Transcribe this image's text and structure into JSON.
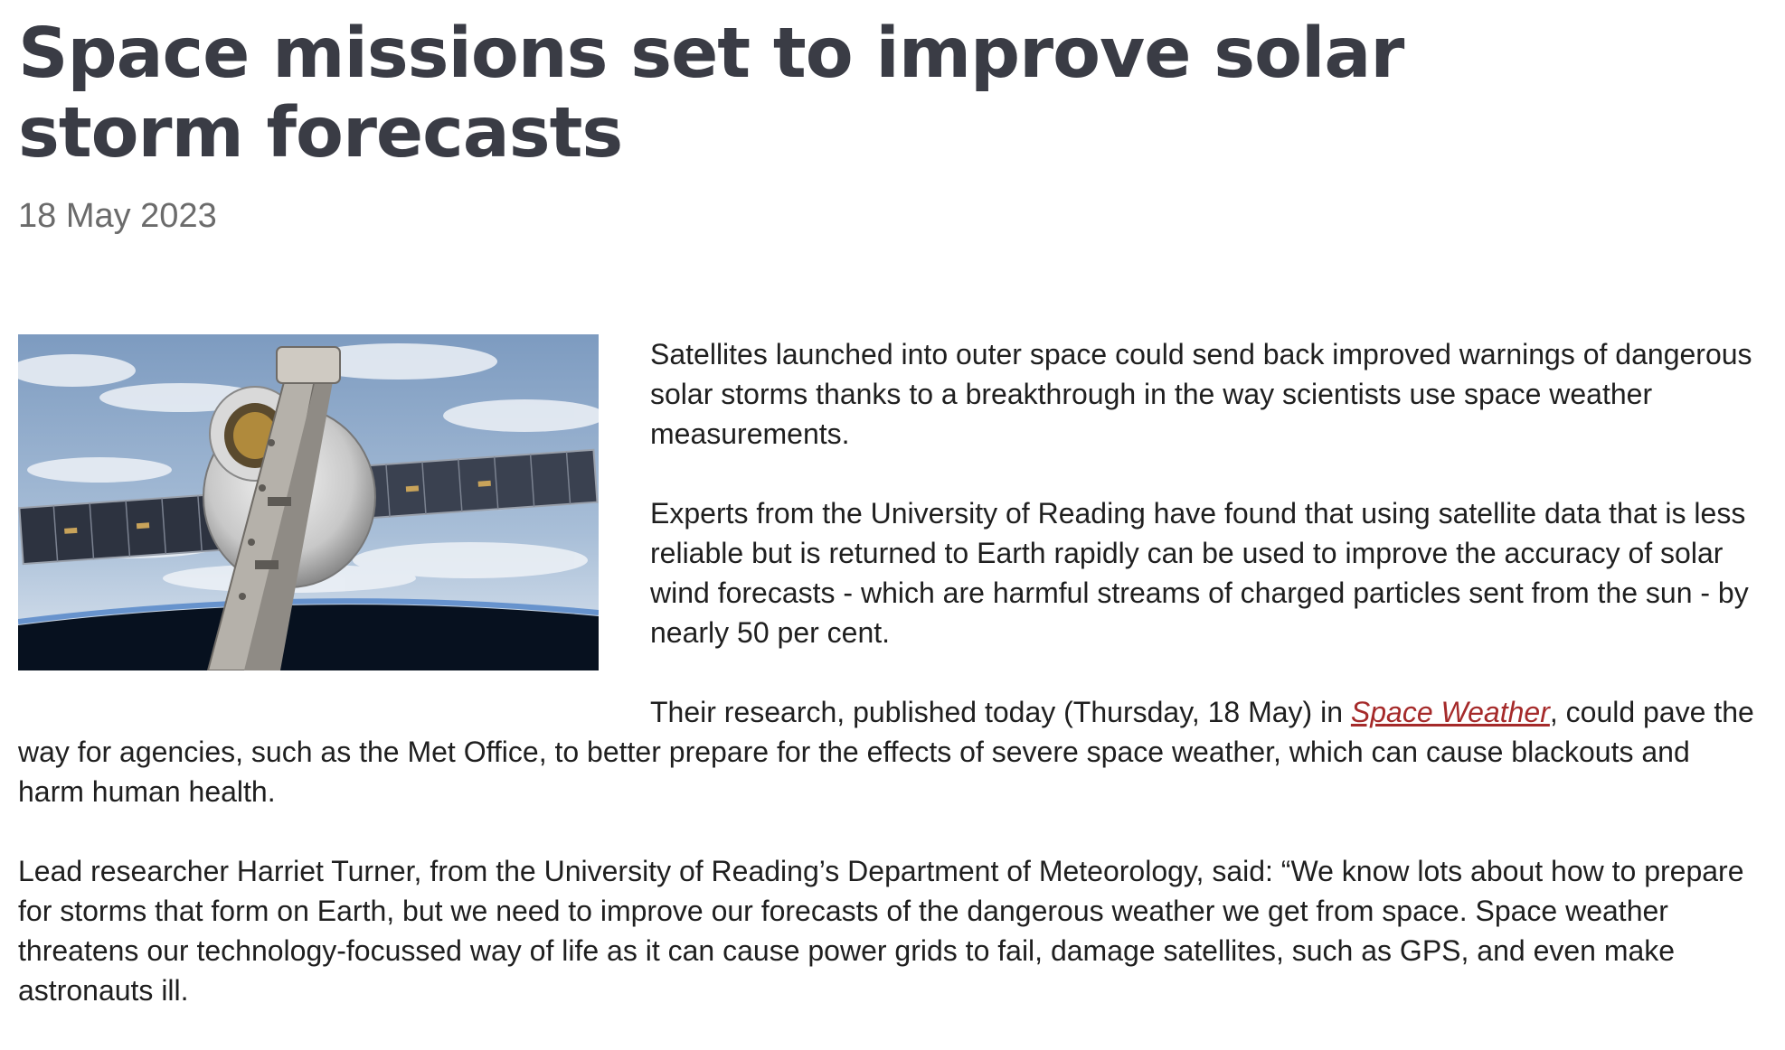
{
  "article": {
    "headline": "Space missions set to improve solar storm forecasts",
    "date": "18 May 2023",
    "paragraphs": [
      {
        "text": "Satellites launched into outer space could send back improved warnings of dangerous solar storms thanks to a breakthrough in the way scientists use space weather measurements."
      },
      {
        "text": "Experts from the University of Reading have found that using satellite data that is less reliable but is returned to Earth rapidly can be used to improve the accuracy of solar wind forecasts - which are harmful streams of charged particles sent from the sun - by nearly 50 per cent."
      },
      {
        "before": "Their research, published today (Thursday, 18 May) in ",
        "link": "Space Weather",
        "after": ", could pave the way for agencies, such as the Met Office, to better prepare for the effects of severe space weather, which can cause blackouts and harm human health."
      },
      {
        "text": "Lead researcher Harriet Turner, from the University of Reading’s Department of Meteorology, said: “We know lots about how to prepare for storms that form on Earth, but we need to improve our forecasts of the dangerous weather we get from space. Space weather threatens our technology-focussed way of life as it can cause power grids to fail, damage satellites, such as GPS, and even make astronauts ill."
      }
    ]
  },
  "colors": {
    "headline": "#3a3c45",
    "date": "#6b6b6b",
    "body_text": "#1f1f1f",
    "link": "#a52a2a"
  }
}
